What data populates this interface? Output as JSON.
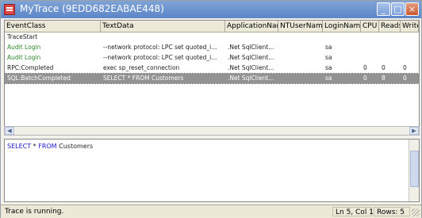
{
  "window": {
    "title": "MyTrace (9EDD682EABAE448)",
    "minimize_label": "_",
    "maximize_label": "□",
    "close_label": "×"
  },
  "columns": [
    "EventClass",
    "TextData",
    "ApplicationName",
    "NTUserName",
    "LoginName",
    "CPU",
    "Reads",
    "Writes"
  ],
  "rows": [
    {
      "event": "TraceStart",
      "text": "",
      "app": "",
      "ntuser": "",
      "login": "",
      "cpu": "",
      "reads": "",
      "writes": "",
      "color": "#222"
    },
    {
      "event": "Audit Login",
      "text": "--network protocol: LPC set quoted_i...",
      "app": ".Net SqlClient...",
      "ntuser": "",
      "login": "sa",
      "cpu": "",
      "reads": "",
      "writes": "",
      "color": "#2d8a2d"
    },
    {
      "event": "Audit Login",
      "text": "--network protocol: LPC set quoted_i...",
      "app": ".Net SqlClient...",
      "ntuser": "",
      "login": "sa",
      "cpu": "",
      "reads": "",
      "writes": "",
      "color": "#2d8a2d"
    },
    {
      "event": "RPC:Completed",
      "text": "exec sp_reset_connection",
      "app": ".Net SqlClient...",
      "ntuser": "",
      "login": "sa",
      "cpu": "0",
      "reads": "0",
      "writes": "0",
      "color": "#222"
    },
    {
      "event": "SQL:BatchCompleted",
      "text": "SELECT * FROM Customers",
      "app": ".Net SqlClient...",
      "ntuser": "",
      "login": "sa",
      "cpu": "0",
      "reads": "8",
      "writes": "0",
      "color": "#fff",
      "selected": true
    }
  ],
  "editor": {
    "kw_select": "SELECT",
    "star": " * ",
    "kw_from": "FROM",
    "table": " Customers"
  },
  "status": {
    "message": "Trace is running.",
    "position": "Ln 5, Col 1",
    "rows": "Rows: 5"
  }
}
